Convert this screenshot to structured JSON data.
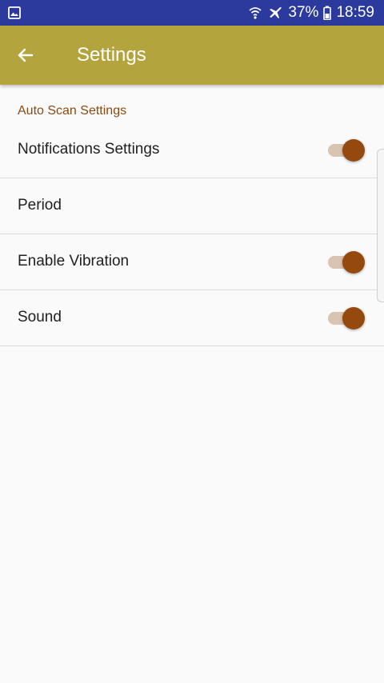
{
  "status_bar": {
    "battery_percent": "37%",
    "time": "18:59",
    "icons": [
      "gallery-icon",
      "wifi-icon",
      "airplane-mode-icon",
      "battery-icon"
    ]
  },
  "app_bar": {
    "title": "Settings",
    "back_icon": "arrow-left-icon"
  },
  "section": {
    "header": "Auto Scan Settings"
  },
  "settings": [
    {
      "label": "Notifications Settings",
      "has_toggle": true,
      "enabled": true
    },
    {
      "label": "Period",
      "has_toggle": false
    },
    {
      "label": "Enable Vibration",
      "has_toggle": true,
      "enabled": true
    },
    {
      "label": "Sound",
      "has_toggle": true,
      "enabled": true
    }
  ],
  "colors": {
    "status_bar": "#2b3a9c",
    "app_bar": "#b4a43e",
    "section_header": "#8a4a12",
    "toggle_thumb": "#96490f",
    "toggle_track": "#d9c3b1",
    "background": "#fafafa"
  }
}
